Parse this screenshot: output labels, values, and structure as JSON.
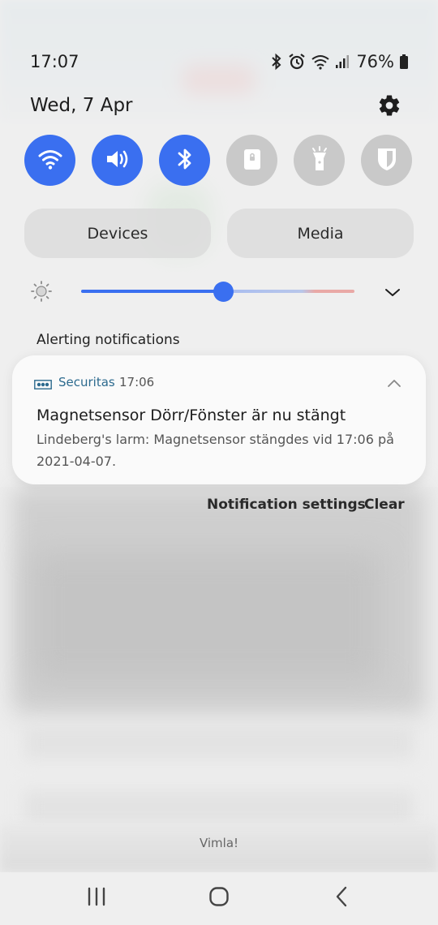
{
  "status_bar": {
    "time": "17:07",
    "battery_percent": "76%",
    "icons": [
      "bluetooth-icon",
      "alarm-icon",
      "wifi-icon",
      "signal-icon",
      "battery-icon"
    ]
  },
  "header": {
    "date": "Wed, 7 Apr",
    "settings_icon": "gear-icon"
  },
  "quick_toggles": [
    {
      "name": "wifi",
      "icon": "wifi-icon",
      "active": true
    },
    {
      "name": "sound",
      "icon": "speaker-icon",
      "active": true
    },
    {
      "name": "bluetooth",
      "icon": "bluetooth-icon",
      "active": true
    },
    {
      "name": "lock",
      "icon": "lock-icon",
      "active": false
    },
    {
      "name": "flashlight",
      "icon": "flashlight-icon",
      "active": false
    },
    {
      "name": "shield",
      "icon": "shield-icon",
      "active": false
    }
  ],
  "buttons": {
    "devices": "Devices",
    "media": "Media"
  },
  "brightness": {
    "level": 0.52
  },
  "notifications": {
    "section_label": "Alerting notifications",
    "items": [
      {
        "app": "Securitas",
        "time": "17:06",
        "title": "Magnetsensor Dörr/Fönster är nu stängt",
        "body": "Lindeberg's larm: Magnetsensor stängdes vid 17:06 på 2021-04-07."
      }
    ],
    "settings_label": "Notification settings",
    "clear_label": "Clear"
  },
  "carrier": "Vimla!",
  "colors": {
    "accent": "#3a6ff0",
    "inactive": "#c9c9c9",
    "app_name": "#2c6a8e"
  }
}
